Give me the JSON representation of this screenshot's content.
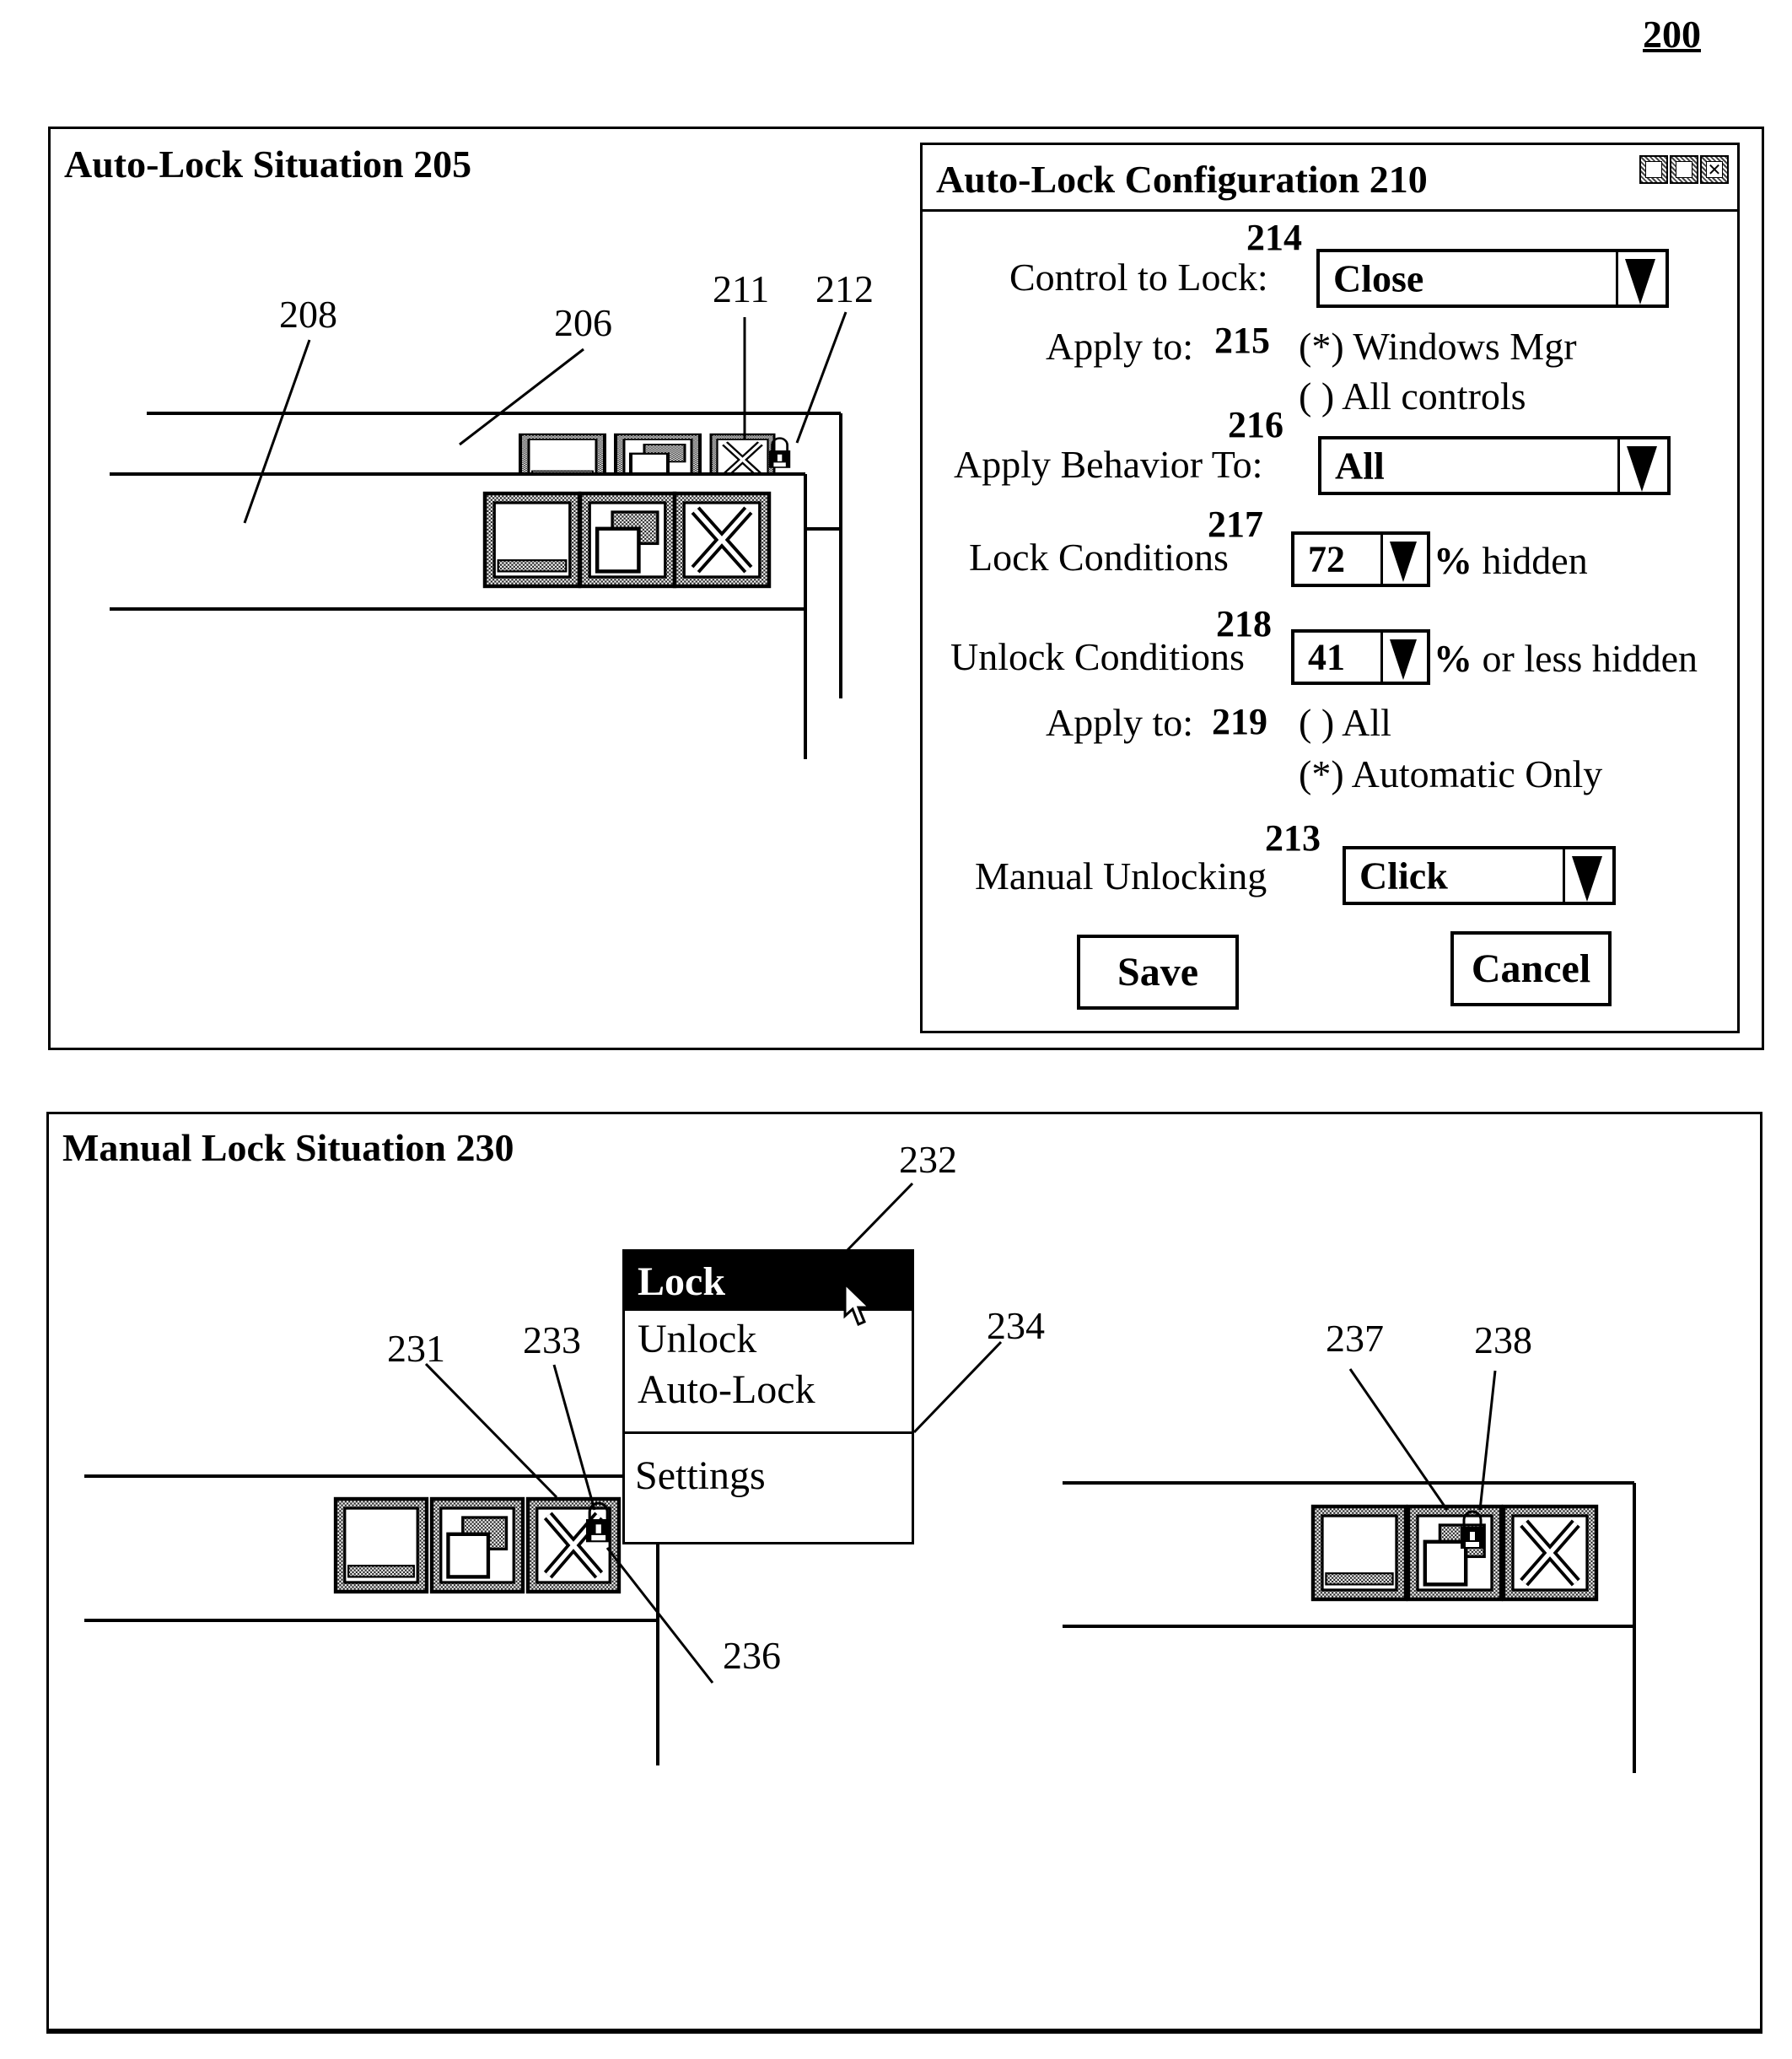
{
  "figure_number": "200",
  "auto_lock_situation": {
    "title": "Auto-Lock Situation 205",
    "refs": {
      "r208": "208",
      "r206": "206",
      "r211": "211",
      "r212": "212"
    },
    "icons": [
      "minimize-icon",
      "restore-icon",
      "close-icon",
      "lock-icon"
    ]
  },
  "config_dialog": {
    "title": "Auto-Lock Configuration 210",
    "titlebar_buttons": [
      "minimize",
      "restore",
      "close"
    ],
    "control_to_lock": {
      "ref": "214",
      "label": "Control to Lock:",
      "value": "Close"
    },
    "apply_to": {
      "ref": "215",
      "label": "Apply to:",
      "options": [
        {
          "marker": "(*)",
          "label": "Windows Mgr",
          "selected": true
        },
        {
          "marker": "( )",
          "label": "All controls",
          "selected": false
        }
      ]
    },
    "apply_behavior_to": {
      "ref": "216",
      "label": "Apply Behavior To:",
      "value": "All"
    },
    "lock_conditions": {
      "ref": "217",
      "label": "Lock Conditions",
      "value": "72",
      "suffix": "% hidden"
    },
    "unlock_conditions": {
      "ref": "218",
      "label": "Unlock Conditions",
      "value": "41",
      "suffix": "% or less hidden"
    },
    "unlock_apply_to": {
      "ref": "219",
      "label": "Apply to:",
      "options": [
        {
          "marker": "( )",
          "label": "All",
          "selected": false
        },
        {
          "marker": "(*)",
          "label": "Automatic Only",
          "selected": true
        }
      ]
    },
    "manual_unlocking": {
      "ref": "213",
      "label": "Manual Unlocking",
      "value": "Click"
    },
    "save_label": "Save",
    "cancel_label": "Cancel"
  },
  "manual_lock_situation": {
    "title": "Manual Lock Situation 230",
    "refs": {
      "r231": "231",
      "r233": "233",
      "r232": "232",
      "r234": "234",
      "r236": "236",
      "r237": "237",
      "r238": "238"
    },
    "context_menu": {
      "items": [
        {
          "label": "Lock",
          "highlighted": true
        },
        {
          "label": "Unlock",
          "highlighted": false
        },
        {
          "label": "Auto-Lock",
          "highlighted": false
        },
        {
          "label": "Settings",
          "highlighted": false
        }
      ]
    }
  }
}
